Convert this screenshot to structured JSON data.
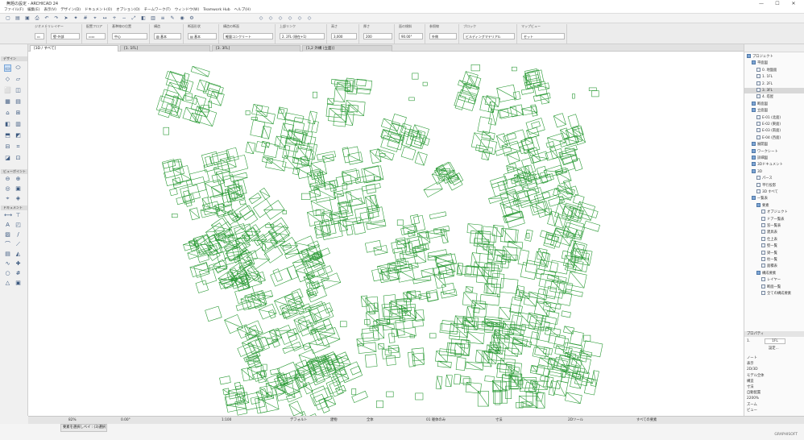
{
  "window": {
    "title": "無題の設定 - ARCHICAD 24",
    "controls": [
      "—",
      "☐",
      "✕"
    ]
  },
  "menu": [
    "ファイル(F)",
    "編集(E)",
    "表示(V)",
    "デザイン(D)",
    "ドキュメント(O)",
    "オプション(O)",
    "チームワーク(T)",
    "ウィンドウ(W)",
    "Teamwork Hub",
    "ヘルプ(H)"
  ],
  "infobox": {
    "sections": [
      {
        "label": "ジオメトリ",
        "value": "▭"
      },
      {
        "label": "レイヤー",
        "value": "壁-外部"
      },
      {
        "label": "配置フロア",
        "value": "▭▭"
      },
      {
        "label": "基準線の位置",
        "value": "中心"
      },
      {
        "label": "構造",
        "value": "▧ 基本"
      },
      {
        "label": "断面形状",
        "value": "▤ 基本"
      },
      {
        "label": "構造の断面",
        "value": "軽量コンクリート"
      },
      {
        "label": "上部リンク",
        "value": "2. 2FL (現在+1)"
      },
      {
        "label": "高さ",
        "value": "3,000"
      },
      {
        "label": "厚さ",
        "value": "200"
      },
      {
        "label": "面の傾斜",
        "value": "90.00°"
      },
      {
        "label": "参照線",
        "value": "外側"
      },
      {
        "label": "ブロック",
        "value": "ビルディングマテリアル"
      },
      {
        "label": "マップビュー",
        "value": "セット"
      }
    ]
  },
  "tabs": [
    "[3D / すべて]",
    "[1. 1FL]",
    "[3. 3FL]",
    "[1,2 外構 (立面)]"
  ],
  "toolbox": {
    "groups": [
      "デザイン",
      "ビューポイント",
      "ドキュメント"
    ]
  },
  "navigator": {
    "items": [
      {
        "label": "プロジェクト",
        "indent": 0,
        "icon": "folder"
      },
      {
        "label": "平面図",
        "indent": 1,
        "icon": "folder"
      },
      {
        "label": "0. 地盤面",
        "indent": 2,
        "icon": "floor"
      },
      {
        "label": "1. 1FL",
        "indent": 2,
        "icon": "floor"
      },
      {
        "label": "2. 2FL",
        "indent": 2,
        "icon": "floor"
      },
      {
        "label": "3. 3FL",
        "indent": 2,
        "icon": "floor",
        "selected": true
      },
      {
        "label": "4. 塔屋",
        "indent": 2,
        "icon": "floor"
      },
      {
        "label": "断面図",
        "indent": 1,
        "icon": "folder"
      },
      {
        "label": "立面図",
        "indent": 1,
        "icon": "folder"
      },
      {
        "label": "E-01 (北面)",
        "indent": 2,
        "icon": "floor"
      },
      {
        "label": "E-02 (東面)",
        "indent": 2,
        "icon": "floor"
      },
      {
        "label": "E-03 (南面)",
        "indent": 2,
        "icon": "floor"
      },
      {
        "label": "E-04 (西面)",
        "indent": 2,
        "icon": "floor"
      },
      {
        "label": "展開図",
        "indent": 1,
        "icon": "folder"
      },
      {
        "label": "ワークシート",
        "indent": 1,
        "icon": "folder"
      },
      {
        "label": "詳細図",
        "indent": 1,
        "icon": "folder"
      },
      {
        "label": "3Dドキュメント",
        "indent": 1,
        "icon": "folder"
      },
      {
        "label": "3D",
        "indent": 1,
        "icon": "folder"
      },
      {
        "label": "パース",
        "indent": 2,
        "icon": "floor"
      },
      {
        "label": "平行投影",
        "indent": 2,
        "icon": "floor"
      },
      {
        "label": "3D すべて",
        "indent": 2,
        "icon": "floor"
      },
      {
        "label": "一覧表",
        "indent": 1,
        "icon": "folder"
      },
      {
        "label": "要素",
        "indent": 2,
        "icon": "folder"
      },
      {
        "label": "オブジェクト",
        "indent": 3,
        "icon": "floor"
      },
      {
        "label": "ドア一覧表",
        "indent": 3,
        "icon": "floor"
      },
      {
        "label": "窓一覧表",
        "indent": 3,
        "icon": "floor"
      },
      {
        "label": "建具表",
        "indent": 3,
        "icon": "floor"
      },
      {
        "label": "仕上表",
        "indent": 3,
        "icon": "floor"
      },
      {
        "label": "壁一覧",
        "indent": 3,
        "icon": "floor"
      },
      {
        "label": "梁一覧",
        "indent": 3,
        "icon": "floor"
      },
      {
        "label": "柱一覧",
        "indent": 3,
        "icon": "floor"
      },
      {
        "label": "面積表",
        "indent": 3,
        "icon": "floor"
      },
      {
        "label": "構成要素",
        "indent": 2,
        "icon": "folder"
      },
      {
        "label": "レイヤー",
        "indent": 3,
        "icon": "floor"
      },
      {
        "label": "断面一覧",
        "indent": 3,
        "icon": "floor"
      },
      {
        "label": "全ての構成要素",
        "indent": 3,
        "icon": "floor"
      }
    ],
    "props_title": "プロパティ",
    "props_id": "1.",
    "props_name": "1FL",
    "props_button": "設定...",
    "bottom_items": [
      "ノート",
      "表示",
      "2D/3D",
      "モデル全体",
      "構造",
      "寸法",
      "自動配置",
      "2200%",
      "ズーム",
      "ビュー"
    ]
  },
  "status": {
    "scale": "1:100",
    "zoom": "82%",
    "angle": "0.00°",
    "layer": "デフォルト",
    "pen": "建物",
    "model": "全体",
    "structure": "01 躯体のみ",
    "renovation": "すべての要素",
    "detail": "2Dツール",
    "dimension": "寸法"
  },
  "command": {
    "text": "要素を選択しベイ : (3)選択レイト"
  },
  "brand": "GRAPHISOFT",
  "colors": {
    "building_stroke": "#2a9a35",
    "selection": "#cbe0f7"
  }
}
